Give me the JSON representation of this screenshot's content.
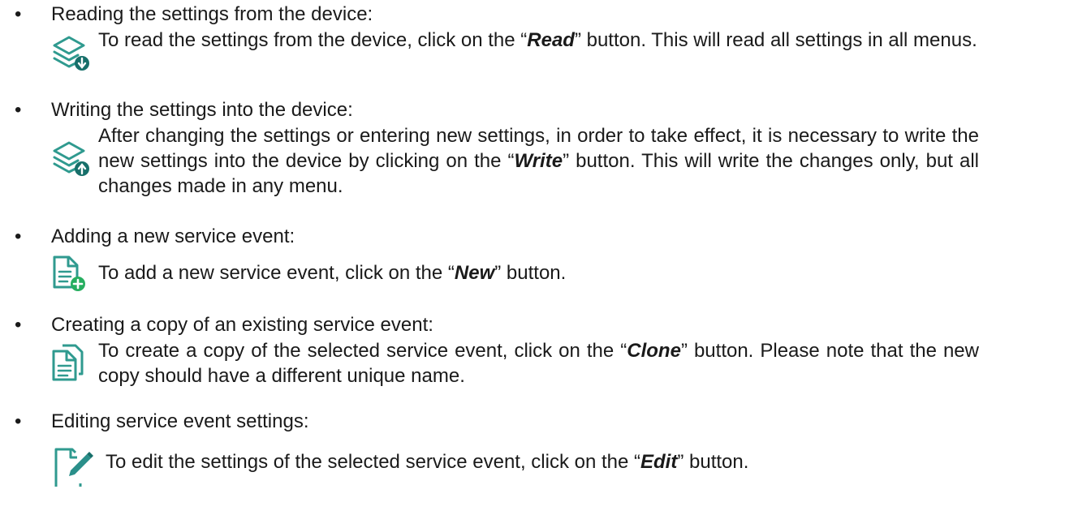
{
  "items": [
    {
      "heading": "Reading the settings from the device:",
      "icon": "read-settings-icon",
      "desc_before": "To read the settings from the device, click on the “",
      "button": "Read",
      "desc_after": "” button. This will read all settings in all menus."
    },
    {
      "heading": "Writing the settings into the device:",
      "icon": "write-settings-icon",
      "desc_before": "After changing the settings or entering new settings, in order to take effect, it is necessary to write the new settings into the device by clicking on the “",
      "button": "Write",
      "desc_after": "” button. This will write the changes only, but all changes made in any menu."
    },
    {
      "heading": "Adding a new service event:",
      "icon": "new-document-icon",
      "desc_before": "To add a new service event, click on the “",
      "button": "New",
      "desc_after": "” button."
    },
    {
      "heading": "Creating a copy of an existing service event:",
      "icon": "clone-document-icon",
      "desc_before": "To create a copy of the selected service event, click on the “",
      "button": "Clone",
      "desc_after": "” button. Please note that the new copy should have a different unique name."
    },
    {
      "heading": "Editing service event settings:",
      "icon": "edit-document-icon",
      "desc_before": "To edit the settings of the selected service event, click on the “",
      "button": "Edit",
      "desc_after": "” button."
    }
  ],
  "colors": {
    "icon_teal": "#2f9a8f",
    "icon_dark_teal": "#176f6a",
    "icon_green": "#27ae60",
    "icon_pencil": "#2a8f8a"
  }
}
